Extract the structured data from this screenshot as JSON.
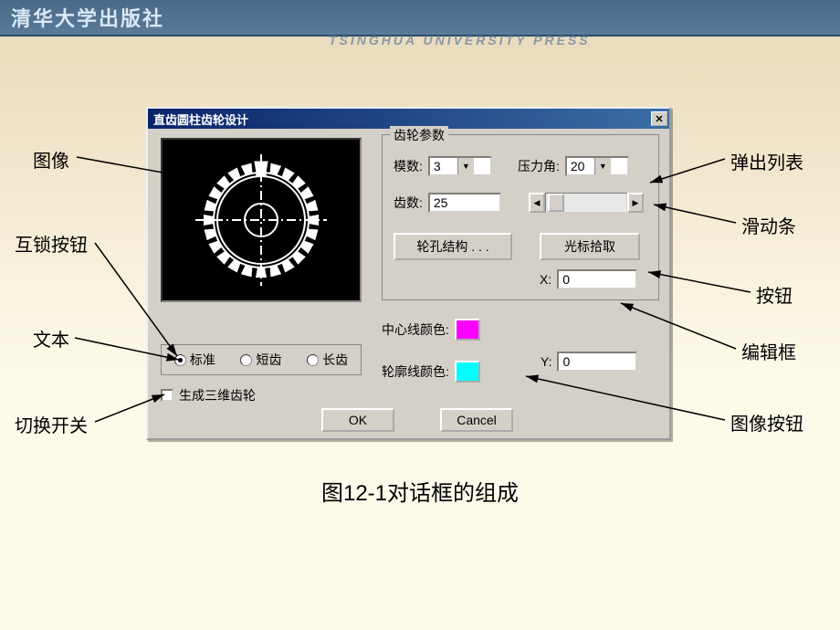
{
  "header": {
    "logo_text": "清华大学出版社",
    "subtitle": "TSINGHUA UNIVERSITY PRESS"
  },
  "dialog": {
    "title": "直齿圆柱齿轮设计",
    "close_symbol": "✕",
    "group_title": "齿轮参数",
    "labels": {
      "modulus": "模数:",
      "pressure_angle": "压力角:",
      "teeth": "齿数:",
      "hole_structure": "轮孔结构 . . .",
      "cursor_pick": "光标拾取",
      "center_line_color": "中心线颜色:",
      "outline_color": "轮廓线颜色:",
      "x": "X:",
      "y": "Y:",
      "ok": "OK",
      "cancel": "Cancel",
      "checkbox_label": "生成三维齿轮"
    },
    "values": {
      "modulus": "3",
      "pressure_angle": "20",
      "teeth": "25",
      "x": "0",
      "y": "0"
    },
    "radios": {
      "standard": "标准",
      "short": "短齿",
      "long": "长齿",
      "selected": "standard"
    },
    "colors": {
      "center_line": "#ff00ff",
      "outline": "#00ffff"
    }
  },
  "annotations": {
    "image": "图像",
    "interlock_button": "互锁按钮",
    "text": "文本",
    "toggle_switch": "切换开关",
    "popup_list": "弹出列表",
    "slider": "滑动条",
    "button": "按钮",
    "edit_box": "编辑框",
    "image_button": "图像按钮"
  },
  "caption": "图12-1对话框的组成"
}
